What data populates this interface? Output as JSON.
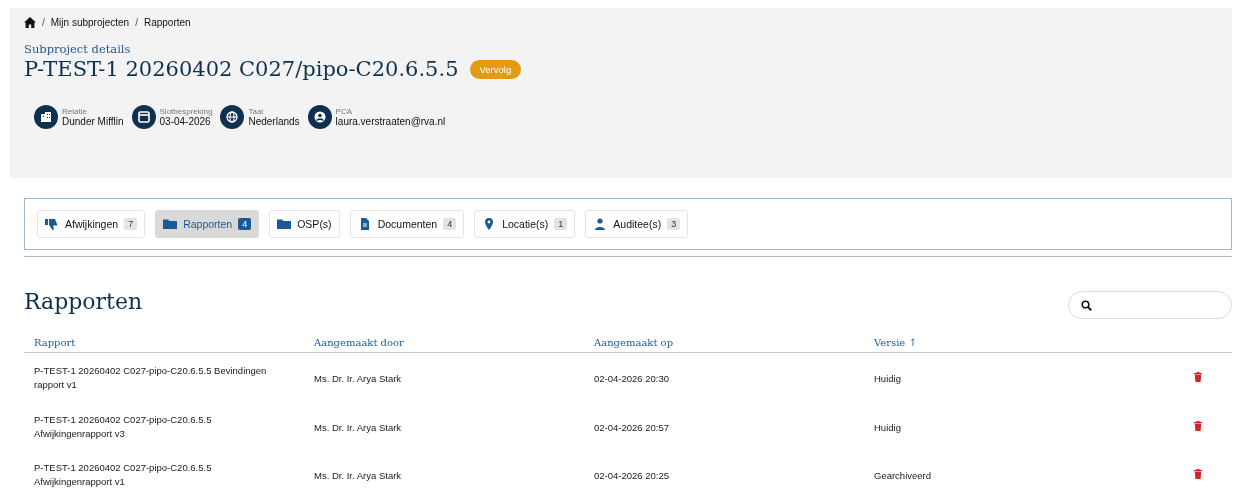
{
  "breadcrumb": {
    "separator": "/",
    "items": [
      "Mijn subprojecten",
      "Rapporten"
    ]
  },
  "header": {
    "subtitle": "Subproject details",
    "title": "P-TEST-1 20260402 C027/pipo-C20.6.5.5",
    "badge": "Vervolg",
    "info": [
      {
        "label": "Relatie",
        "value": "Dunder Mifflin"
      },
      {
        "label": "Slotbespreking",
        "value": "03-04-2026"
      },
      {
        "label": "Taal",
        "value": "Nederlands"
      },
      {
        "label": "PCA",
        "value": "laura.verstraaten@rva.nl"
      }
    ]
  },
  "tabs": [
    {
      "label": "Afwijkingen",
      "count": "7",
      "selected": false
    },
    {
      "label": "Rapporten",
      "count": "4",
      "selected": true
    },
    {
      "label": "OSP(s)",
      "selected": false
    },
    {
      "label": "Documenten",
      "count": "4",
      "selected": false
    },
    {
      "label": "Locatie(s)",
      "count": "1",
      "selected": false
    },
    {
      "label": "Auditee(s)",
      "count": "3",
      "selected": false
    }
  ],
  "section": {
    "title": "Rapporten"
  },
  "table": {
    "columns": [
      "Rapport",
      "Aangemaakt door",
      "Aangemaakt op",
      "Versie ↑"
    ],
    "rows": [
      {
        "rapport": "P-TEST-1 20260402 C027-pipo-C20.6.5.5 Bevindingen rapport v1",
        "door": "Ms. Dr. Ir. Arya Stark",
        "op": "02-04-2026 20:30",
        "versie": "Huidig"
      },
      {
        "rapport": "P-TEST-1 20260402 C027-pipo-C20.6.5.5 Afwijkingenrapport v3",
        "door": "Ms. Dr. Ir. Arya Stark",
        "op": "02-04-2026 20:57",
        "versie": "Huidig"
      },
      {
        "rapport": "P-TEST-1 20260402 C027-pipo-C20.6.5.5 Afwijkingenrapport v1",
        "door": "Ms. Dr. Ir. Arya Stark",
        "op": "02-04-2026 20:25",
        "versie": "Gearchiveerd"
      }
    ]
  }
}
